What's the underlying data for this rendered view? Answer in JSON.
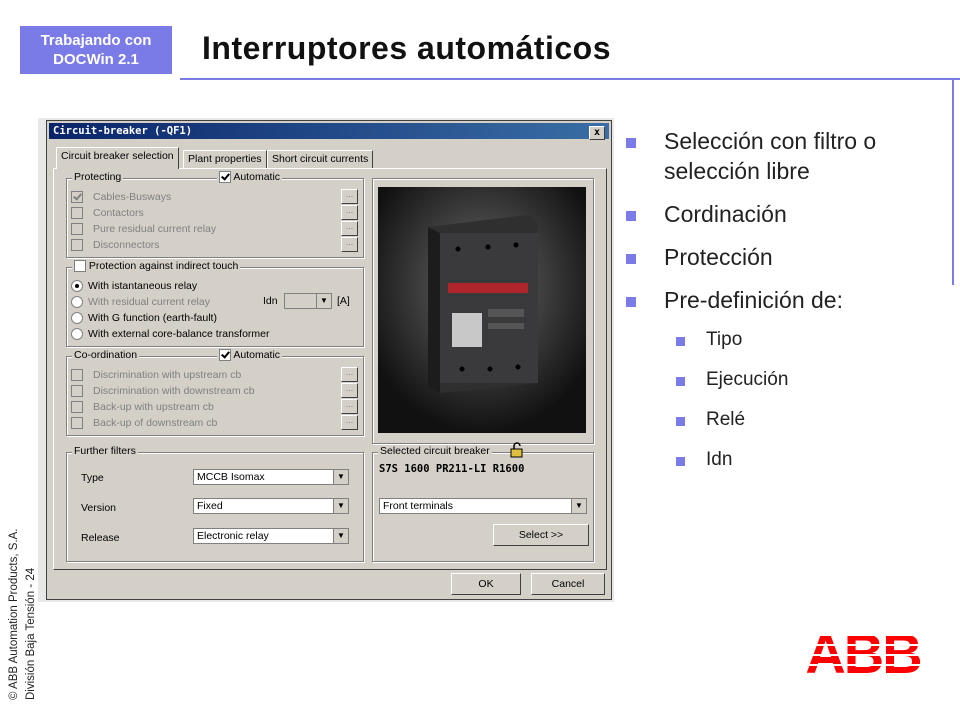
{
  "header": {
    "tag_line1": "Trabajando con",
    "tag_line2": "DOCWin 2.1",
    "title": "Interruptores automáticos"
  },
  "footer": {
    "line1": "© ABB Automation Products, S.A.",
    "line2": "División Baja Tensión - 24"
  },
  "logo": {
    "text": "ABB",
    "color": "#ff0000"
  },
  "colors": {
    "accent": "#7b7be8",
    "dialog_face": "#d4d0c8",
    "caption": "#0a246a"
  },
  "bullets": {
    "main": [
      {
        "text": "Selección con filtro o selección libre"
      },
      {
        "text": "Cordinación"
      },
      {
        "text": "Protección"
      },
      {
        "text": "Pre-definición de:"
      }
    ],
    "sub": [
      {
        "text": "Tipo"
      },
      {
        "text": "Ejecución"
      },
      {
        "text": "Relé"
      },
      {
        "text": "Idn"
      }
    ]
  },
  "dialog": {
    "title": "Circuit-breaker  (-QF1)",
    "close": "x",
    "tabs": [
      "Circuit breaker selection",
      "Plant properties",
      "Short circuit currents"
    ],
    "protecting": {
      "label": "Protecting",
      "automatic": "Automatic",
      "items": [
        "Cables-Busways",
        "Contactors",
        "Pure residual current relay",
        "Disconnectors"
      ],
      "dots": "..."
    },
    "indirect": {
      "label": "Protection against indirect touch",
      "options": [
        "With istantaneous relay",
        "With residual current relay",
        "With G function (earth-fault)",
        "With external core-balance transformer"
      ],
      "idn_label": "Idn",
      "idn_unit": "[A]"
    },
    "coordination": {
      "label": "Co-ordination",
      "automatic": "Automatic",
      "items": [
        "Discrimination with upstream cb",
        "Discrimination with downstream cb",
        "Back-up with upstream cb",
        "Back-up of downstream cb"
      ]
    },
    "filters": {
      "label": "Further filters",
      "type_label": "Type",
      "type_value": "MCCB Isomax",
      "version_label": "Version",
      "version_value": "Fixed",
      "release_label": "Release",
      "release_value": "Electronic relay"
    },
    "selected": {
      "label": "Selected circuit breaker",
      "value": "S7S 1600 PR211-LI R1600",
      "terminals": "Front terminals",
      "select_button": "Select >>"
    },
    "ok": "OK",
    "cancel": "Cancel"
  }
}
